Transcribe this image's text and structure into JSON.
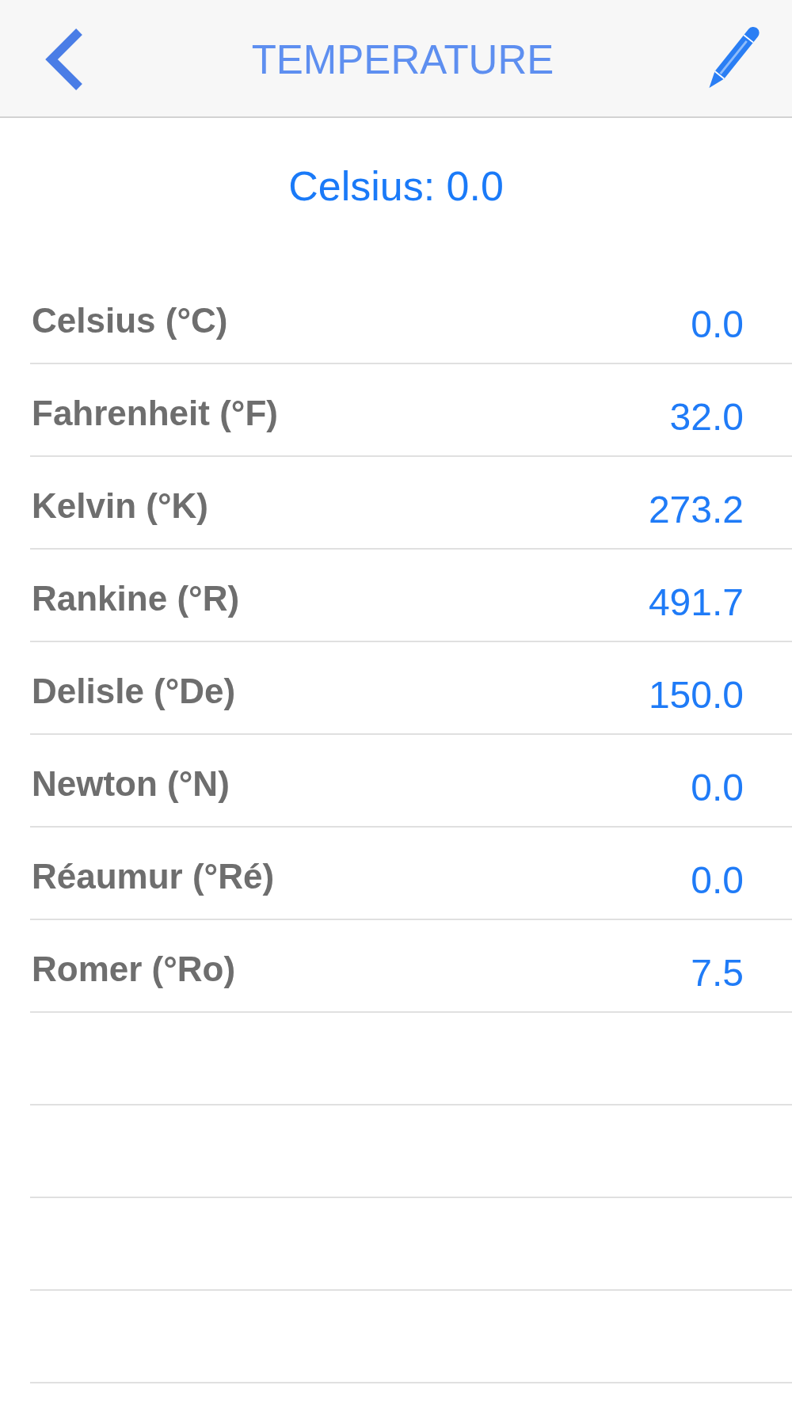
{
  "nav": {
    "title": "TEMPERATURE"
  },
  "result": {
    "text": "Celsius: 0.0"
  },
  "units": [
    {
      "name": "Celsius (°C)",
      "value": "0.0"
    },
    {
      "name": "Fahrenheit (°F)",
      "value": "32.0"
    },
    {
      "name": "Kelvin (°K)",
      "value": "273.2"
    },
    {
      "name": "Rankine (°R)",
      "value": "491.7"
    },
    {
      "name": "Delisle (°De)",
      "value": "150.0"
    },
    {
      "name": "Newton (°N)",
      "value": "0.0"
    },
    {
      "name": "Réaumur (°Ré)",
      "value": "0.0"
    },
    {
      "name": "Romer (°Ro)",
      "value": "7.5"
    }
  ]
}
